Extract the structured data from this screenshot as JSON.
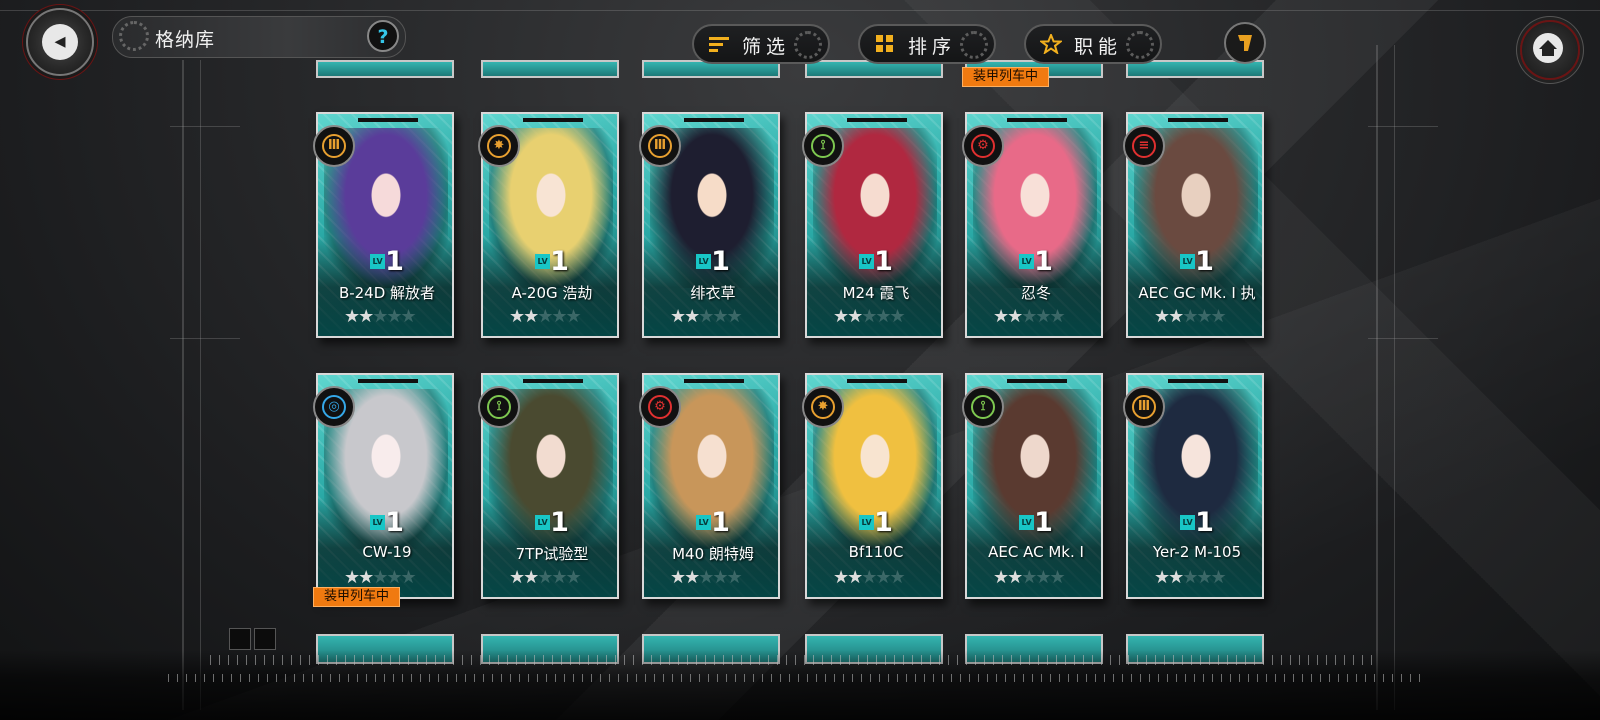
{
  "header": {
    "title": "格纳库",
    "help_label": "?",
    "filter_label": "筛选",
    "sort_label": "排序",
    "role_label": "职能"
  },
  "train_tag": "装甲列车中",
  "row1": [
    {
      "name": "B-24D 解放者",
      "level": "1",
      "role_color": "#e8a030"
    },
    {
      "name": "A-20G 浩劫",
      "level": "1",
      "role_color": "#e8a030"
    },
    {
      "name": "绯衣草",
      "level": "1",
      "role_color": "#e8a030"
    },
    {
      "name": "M24 霞飞",
      "level": "1",
      "role_color": "#7ec850"
    },
    {
      "name": "忍冬",
      "level": "1",
      "role_color": "#e03030"
    },
    {
      "name": "AEC GC Mk. I 执",
      "level": "1",
      "role_color": "#e03030"
    }
  ],
  "row2": [
    {
      "name": "CW-19",
      "level": "1",
      "role_color": "#35a8e8"
    },
    {
      "name": "7TP试验型",
      "level": "1",
      "role_color": "#7ec850"
    },
    {
      "name": "M40 朗特姆",
      "level": "1",
      "role_color": "#e03030"
    },
    {
      "name": "Bf110C",
      "level": "1",
      "role_color": "#e8a030"
    },
    {
      "name": "AEC AC Mk. I",
      "level": "1",
      "role_color": "#7ec850"
    },
    {
      "name": "Yer-2 M-105",
      "level": "1",
      "role_color": "#e8a030"
    }
  ],
  "lv_label": "LV",
  "stars": "★★",
  "stars_empty": "★★★",
  "colors": {
    "accent": "#2aa9a6",
    "tag": "#f07a10"
  }
}
